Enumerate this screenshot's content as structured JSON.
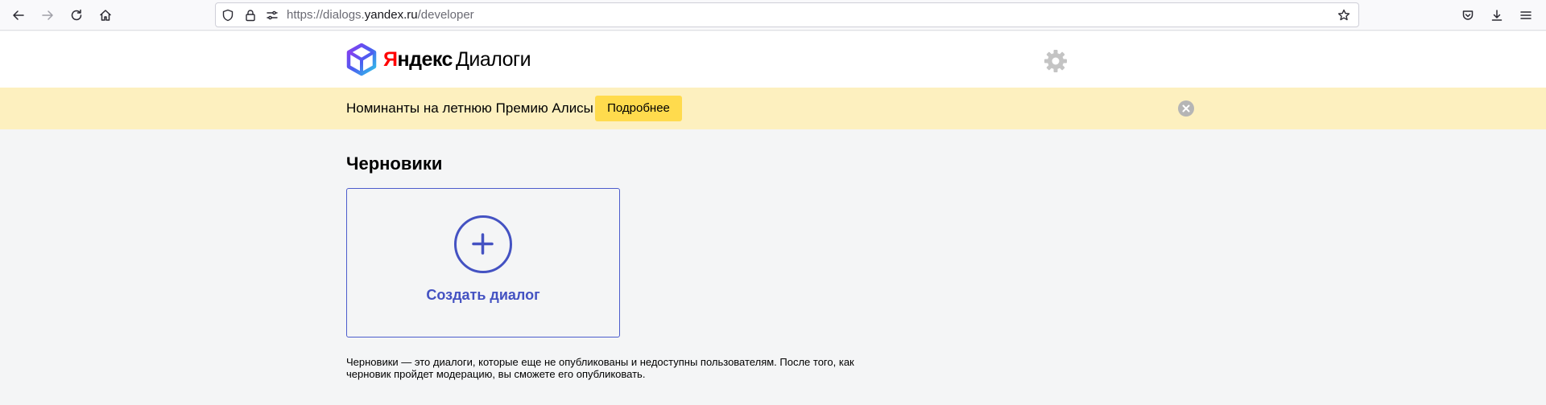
{
  "browser": {
    "url_prefix": "https://dialogs.",
    "url_domain": "yandex.ru",
    "url_path": "/developer",
    "icons": [
      "back-icon",
      "forward-icon",
      "reload-icon",
      "home-icon",
      "shield-icon",
      "lock-icon",
      "permissions-icon",
      "bookmark-star-icon",
      "pocket-icon",
      "download-icon",
      "menu-icon"
    ]
  },
  "header": {
    "logo_ya": "Я",
    "logo_ndex": "ндекс",
    "logo_product": "Диалоги",
    "settings_icon": "gear-icon"
  },
  "banner": {
    "text": "Номинанты на летнюю Премию Алисы",
    "button_label": "Подробнее",
    "close_icon": "close-icon",
    "background": "#fdf0bf",
    "button_color": "#ffdb4d"
  },
  "main": {
    "section_title": "Черновики",
    "create_label": "Создать диалог",
    "create_icon": "plus-circle-icon",
    "note": "Черновики — это диалоги, которые еще не опубликованы и недоступны пользователям. После того, как черновик пройдет модерацию, вы сможете его опубликовать.",
    "accent": "#4452c2"
  }
}
